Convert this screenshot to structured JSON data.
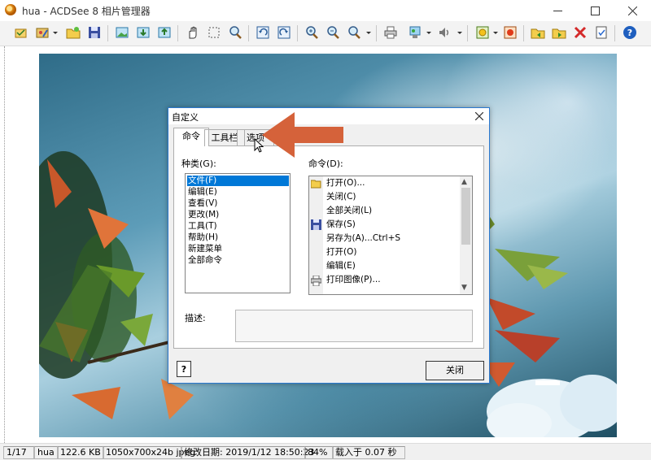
{
  "window": {
    "title": "hua - ACDSee 8 相片管理器"
  },
  "toolbar": {
    "icons": [
      "acquire-icon",
      "edit-icon",
      "open-icon",
      "save-icon",
      "add-image-icon",
      "import-icon",
      "export-icon",
      "hand-icon",
      "select-icon",
      "zoom-tool-icon",
      "rotate-left-icon",
      "rotate-right-icon",
      "zoom-in-icon",
      "zoom-out-icon",
      "zoom-dropdown-icon",
      "print-icon",
      "wallpaper-icon",
      "audio-icon",
      "plugin-icon",
      "color-icon",
      "prev-folder-icon",
      "next-folder-icon",
      "delete-icon",
      "properties-icon",
      "help-icon"
    ]
  },
  "dialog": {
    "title": "自定义",
    "tabs": [
      "命令",
      "工具栏",
      "选项"
    ],
    "category_label": "种类(G):",
    "command_label": "命令(D):",
    "categories": [
      "文件(F)",
      "编辑(E)",
      "查看(V)",
      "更改(M)",
      "工具(T)",
      "帮助(H)",
      "新建菜单",
      "全部命令"
    ],
    "selected_category": 0,
    "commands": [
      {
        "label": "打开(O)...",
        "icon": "open-folder-icon"
      },
      {
        "label": "关闭(C)",
        "icon": ""
      },
      {
        "label": "全部关闭(L)",
        "icon": ""
      },
      {
        "label": "保存(S)",
        "icon": "save-icon"
      },
      {
        "label": "另存为(A)...Ctrl+S",
        "icon": ""
      },
      {
        "label": "打开(O)",
        "icon": ""
      },
      {
        "label": "编辑(E)",
        "icon": ""
      },
      {
        "label": "打印图像(P)...",
        "icon": "print-icon"
      }
    ],
    "description_label": "描述:",
    "help_button": "?",
    "close_button": "关闭"
  },
  "colors": {
    "accent": "#0078d7",
    "arrow": "#d5623a",
    "dialog_border": "#2b79d0"
  },
  "statusbar": {
    "position": "1/17",
    "name": "hua",
    "size": "122.6 KB",
    "dimensions": "1050x700x24b jpeg",
    "modified": "修改日期: 2019/1/12 18:50:23",
    "zoom": "84%",
    "load_time": "载入于 0.07 秒"
  }
}
